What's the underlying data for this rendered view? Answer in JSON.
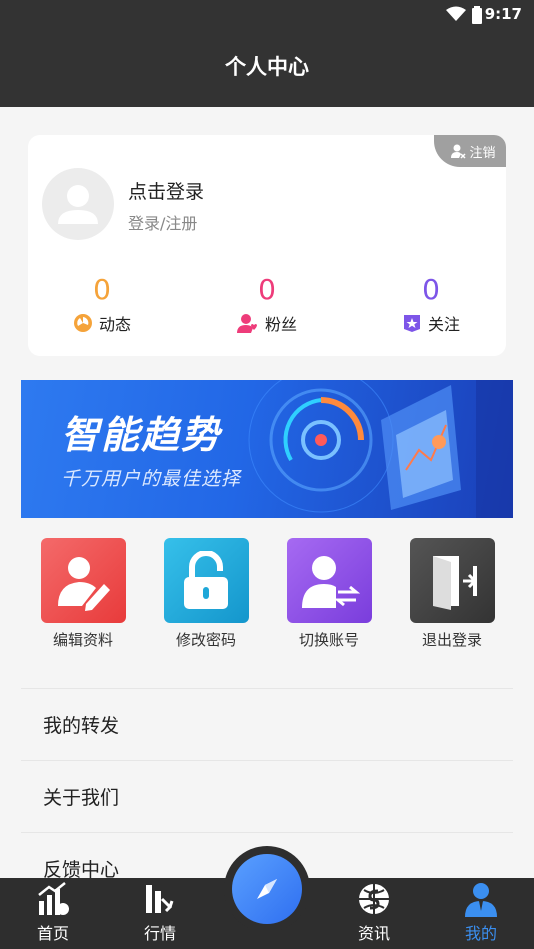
{
  "status": {
    "time": "9:17"
  },
  "header": {
    "title": "个人中心"
  },
  "profile": {
    "login_title": "点击登录",
    "login_subtitle": "登录/注册",
    "logout_tag": "注销",
    "stats": [
      {
        "value": "0",
        "label": "动态",
        "icon": "dynamic-icon",
        "color": "#f5a33a"
      },
      {
        "value": "0",
        "label": "粉丝",
        "icon": "fans-icon",
        "color": "#ee3c7a"
      },
      {
        "value": "0",
        "label": "关注",
        "icon": "follow-star-icon",
        "color": "#7d55e8"
      }
    ]
  },
  "banner": {
    "title": "智能趋势",
    "subtitle": "千万用户的最佳选择"
  },
  "actions": [
    {
      "label": "编辑资料",
      "icon": "edit-profile-icon",
      "color": "#ef4b4b"
    },
    {
      "label": "修改密码",
      "icon": "lock-icon",
      "color": "#1eaad6"
    },
    {
      "label": "切换账号",
      "icon": "switch-account-icon",
      "color": "#8c4ee6"
    },
    {
      "label": "退出登录",
      "icon": "exit-door-icon",
      "color": "#444444"
    }
  ],
  "menu": [
    {
      "label": "我的转发"
    },
    {
      "label": "关于我们"
    },
    {
      "label": "反馈中心"
    }
  ],
  "tabs": [
    {
      "label": "首页",
      "icon": "home-chart-icon"
    },
    {
      "label": "行情",
      "icon": "market-icon"
    },
    {
      "label": "资讯",
      "icon": "news-globe-icon"
    },
    {
      "label": "我的",
      "icon": "profile-icon",
      "active": true
    }
  ],
  "colors": {
    "header_bg": "#333333",
    "accent_blue": "#3b8ff0"
  }
}
